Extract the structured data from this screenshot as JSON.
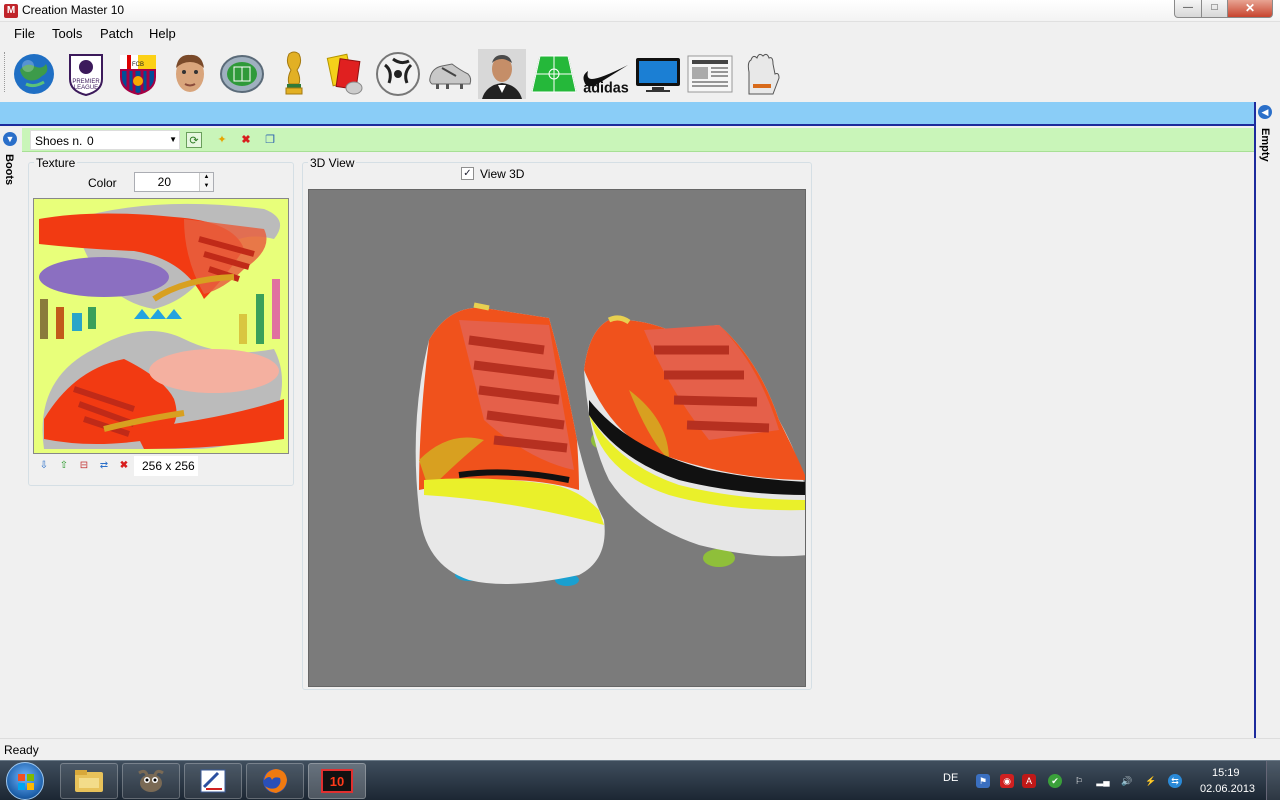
{
  "window": {
    "title": "Creation Master 10",
    "app_icon": "M",
    "min": "—",
    "max": "□",
    "close": "✕"
  },
  "menu": [
    "File",
    "Tools",
    "Patch",
    "Help"
  ],
  "toolbar_icons": [
    "globe-icon",
    "premier-league-icon",
    "fc-barcelona-icon",
    "player-face-icon",
    "stadium-icon",
    "world-cup-trophy-icon",
    "referee-cards-icon",
    "football-icon",
    "boots-icon",
    "manager-icon",
    "pitch-icon",
    "nike-icon",
    "adidas-icon",
    "tv-screen-icon",
    "newspaper-icon",
    "goalkeeper-gloves-icon"
  ],
  "toolbar_labels": {
    "premier_top": "PREMIER",
    "premier_bottom": "LEAGUE",
    "barca": "FCB",
    "adidas": "adidas"
  },
  "left_panel": {
    "label": "Boots"
  },
  "right_panel": {
    "label": "Empty"
  },
  "shoes_bar": {
    "label": "Shoes n.",
    "value": "0"
  },
  "texture": {
    "legend": "Texture",
    "color_label": "Color",
    "color_value": "20",
    "size": "256 x 256"
  },
  "view3d": {
    "legend": "3D View",
    "checkbox_label": "View 3D",
    "checked": "✓"
  },
  "status": {
    "text": "Ready"
  },
  "taskbar": {
    "apps": [
      "explorer-icon",
      "gimp-icon",
      "paint-icon",
      "firefox-icon",
      "creation-master-icon"
    ],
    "cm_label": "10",
    "lang": "DE",
    "time": "15:19",
    "date": "02.06.2013"
  },
  "colors": {
    "accent_blue": "#8acdf7",
    "accent_green": "#c9f5b9",
    "border_navy": "#1d2b9d",
    "viewport_gray": "#7b7b7b",
    "texture_bg": "#e8ff7a"
  }
}
